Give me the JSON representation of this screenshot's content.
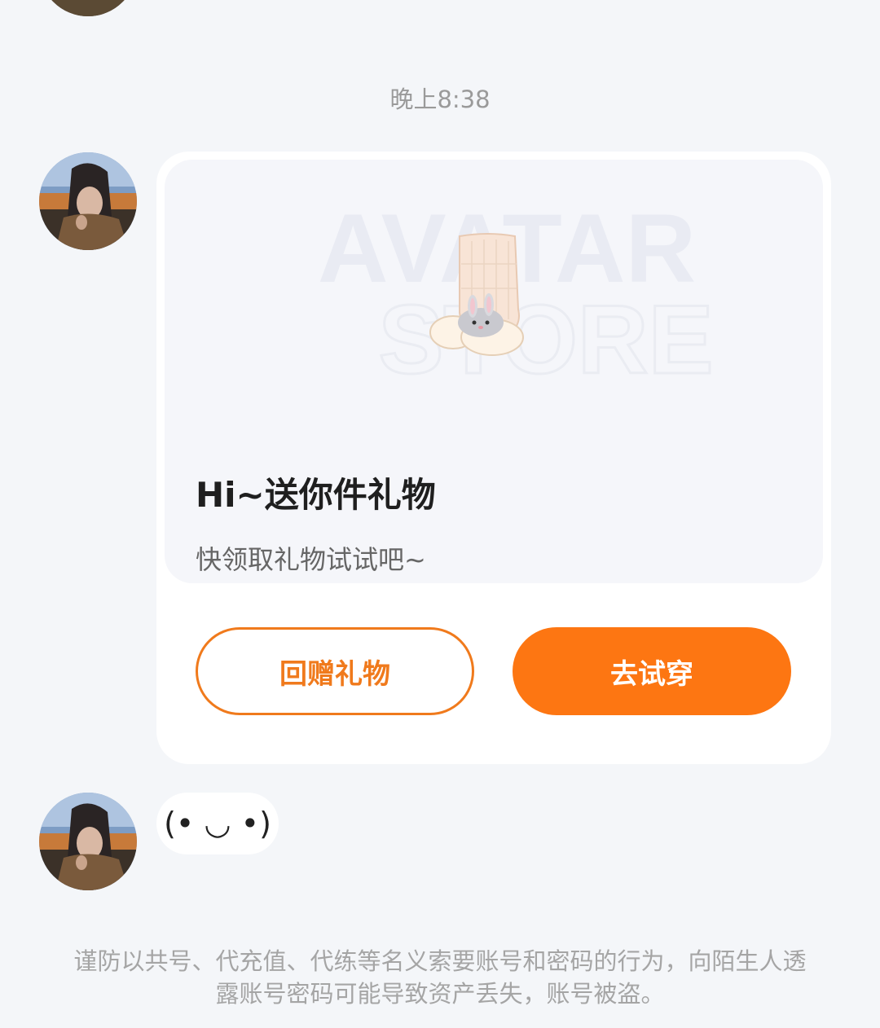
{
  "chat": {
    "timestamp": "晚上8:38",
    "gift_card": {
      "banner_brand": [
        "AVATAR",
        "STORE"
      ],
      "title": "Hi~送你件礼物",
      "subtitle": "快领取礼物试试吧~",
      "return_gift_label": "回赠礼物",
      "try_on_label": "去试穿",
      "accent_color": "#fd7612"
    },
    "emoji_message": "(๑•̀ ᴗ •́๑)",
    "emoji_display": "(• ◡ •)"
  },
  "security_notice": "谨防以共号、代充值、代练等名义索要账号和密码的行为，向陌生人透露账号密码可能导致资产丢失，账号被盗。"
}
